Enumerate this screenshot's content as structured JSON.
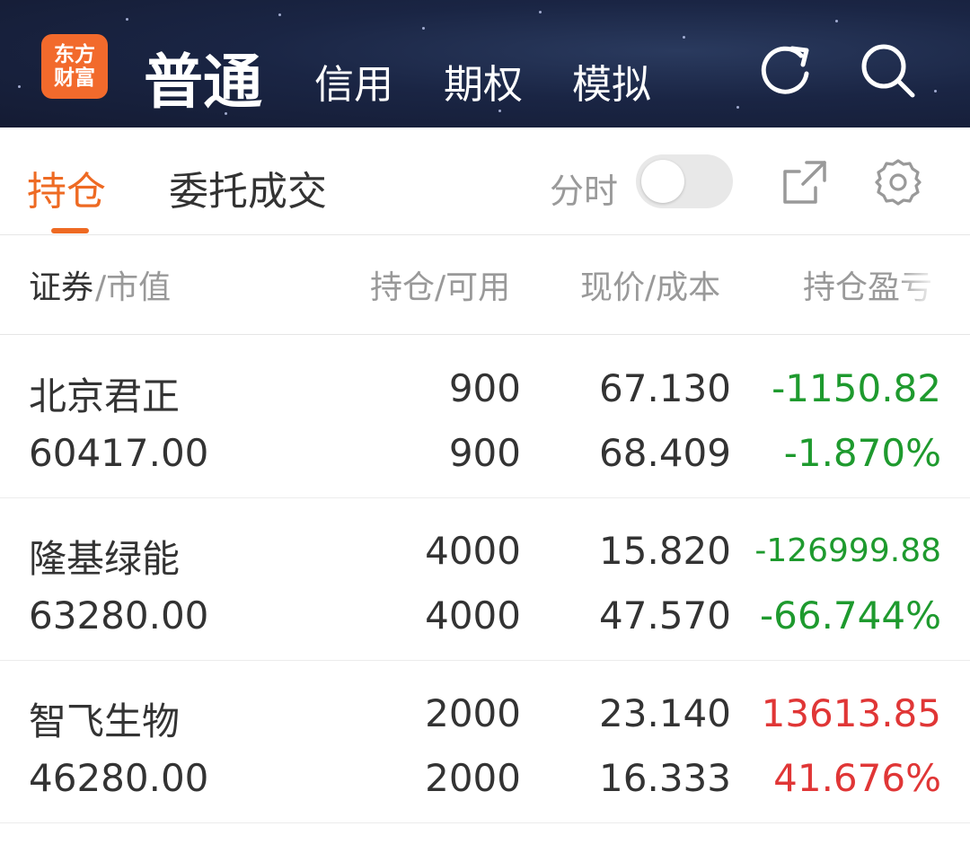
{
  "header": {
    "logo_line1": "东方",
    "logo_line2": "财富",
    "tabs": [
      {
        "label": "普通",
        "active": true
      },
      {
        "label": "信用",
        "active": false
      },
      {
        "label": "期权",
        "active": false
      },
      {
        "label": "模拟",
        "active": false
      }
    ],
    "icons": [
      "refresh-icon",
      "search-icon"
    ]
  },
  "subtabs": {
    "items": [
      {
        "label": "持仓",
        "active": true
      },
      {
        "label": "委托成交",
        "active": false
      }
    ],
    "toggle_label": "分时",
    "toggle_on": false,
    "icons": [
      "share-icon",
      "settings-icon"
    ]
  },
  "columns": {
    "security": "证券",
    "market_value": "/市值",
    "position": "持仓/可用",
    "price": "现价/成本",
    "pnl": "持仓盈亏"
  },
  "holdings": [
    {
      "name": "北京君正",
      "market_value": "60417.00",
      "position": "900",
      "available": "900",
      "price": "67.130",
      "cost": "68.409",
      "pnl": "-1150.82",
      "pnl_pct": "-1.870%",
      "trend": "down"
    },
    {
      "name": "隆基绿能",
      "market_value": "63280.00",
      "position": "4000",
      "available": "4000",
      "price": "15.820",
      "cost": "47.570",
      "pnl": "-126999.88",
      "pnl_pct": "-66.744%",
      "trend": "down"
    },
    {
      "name": "智飞生物",
      "market_value": "46280.00",
      "position": "2000",
      "available": "2000",
      "price": "23.140",
      "cost": "16.333",
      "pnl": "13613.85",
      "pnl_pct": "41.676%",
      "trend": "up"
    }
  ],
  "colors": {
    "accent": "#ee6a23",
    "up": "#e03636",
    "down": "#1e9a2e",
    "header_bg": "#1a2544"
  }
}
